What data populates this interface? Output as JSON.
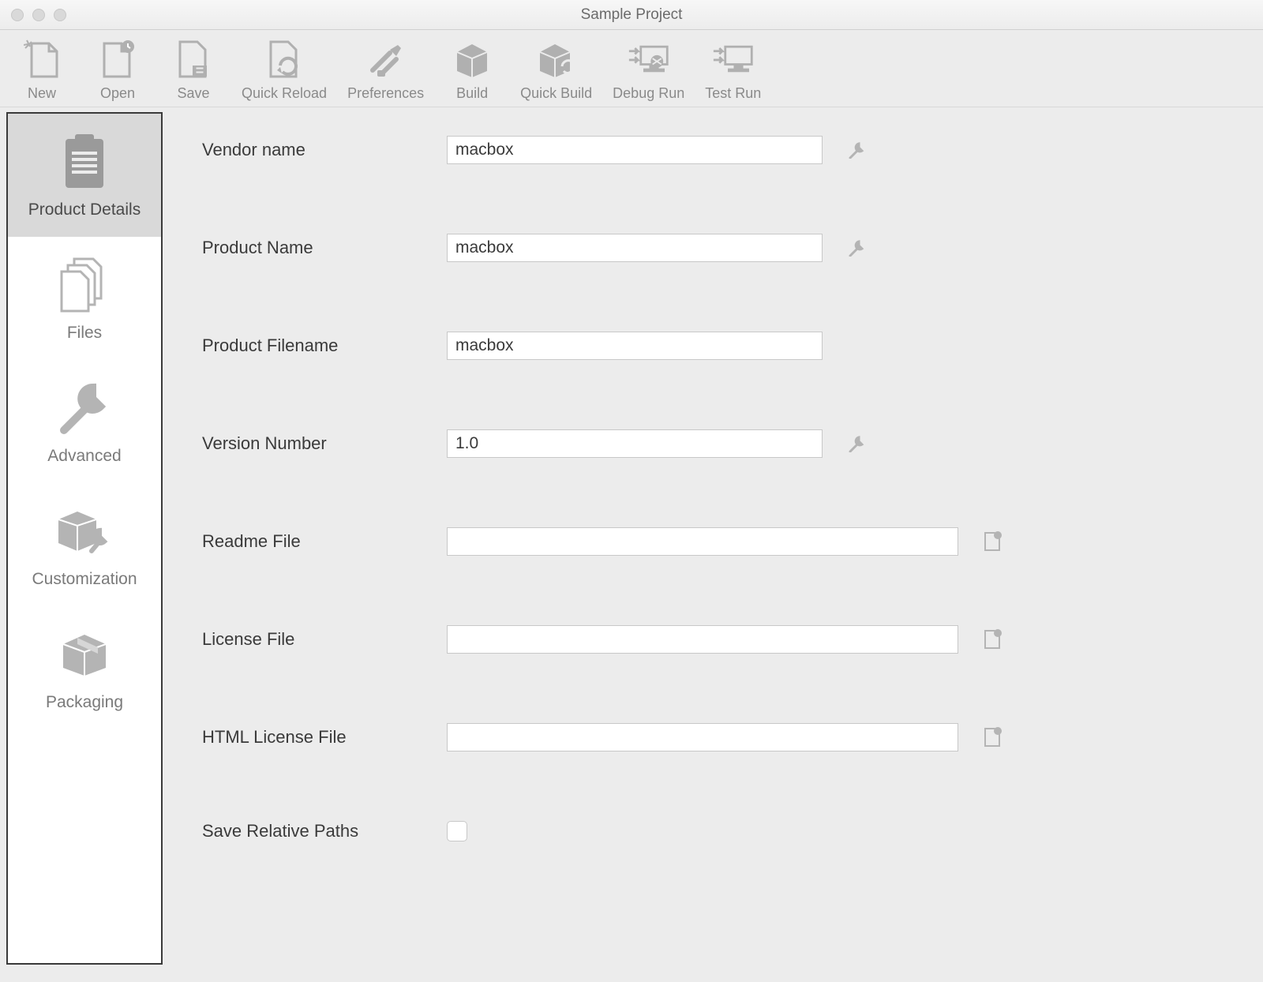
{
  "window": {
    "title": "Sample Project"
  },
  "toolbar": [
    {
      "id": "new",
      "label": "New"
    },
    {
      "id": "open",
      "label": "Open"
    },
    {
      "id": "save",
      "label": "Save"
    },
    {
      "id": "quick-reload",
      "label": "Quick Reload"
    },
    {
      "id": "preferences",
      "label": "Preferences"
    },
    {
      "id": "build",
      "label": "Build"
    },
    {
      "id": "quick-build",
      "label": "Quick Build"
    },
    {
      "id": "debug-run",
      "label": "Debug Run"
    },
    {
      "id": "test-run",
      "label": "Test Run"
    }
  ],
  "sidebar": [
    {
      "id": "product-details",
      "label": "Product Details",
      "selected": true
    },
    {
      "id": "files",
      "label": "Files"
    },
    {
      "id": "advanced",
      "label": "Advanced"
    },
    {
      "id": "customization",
      "label": "Customization"
    },
    {
      "id": "packaging",
      "label": "Packaging"
    }
  ],
  "form": {
    "vendor_name": {
      "label": "Vendor name",
      "value": "macbox",
      "variant": "short",
      "action": "wrench"
    },
    "product_name": {
      "label": "Product Name",
      "value": "macbox",
      "variant": "short",
      "action": "wrench"
    },
    "product_filename": {
      "label": "Product Filename",
      "value": "macbox",
      "variant": "short",
      "action": null
    },
    "version_number": {
      "label": "Version Number",
      "value": "1.0",
      "variant": "short",
      "action": "wrench"
    },
    "readme_file": {
      "label": "Readme File",
      "value": "",
      "variant": "long",
      "action": "browse"
    },
    "license_file": {
      "label": "License File",
      "value": "",
      "variant": "long",
      "action": "browse"
    },
    "html_license_file": {
      "label": "HTML License File",
      "value": "",
      "variant": "long",
      "action": "browse"
    },
    "save_relative": {
      "label": "Save Relative Paths",
      "checked": false
    }
  }
}
